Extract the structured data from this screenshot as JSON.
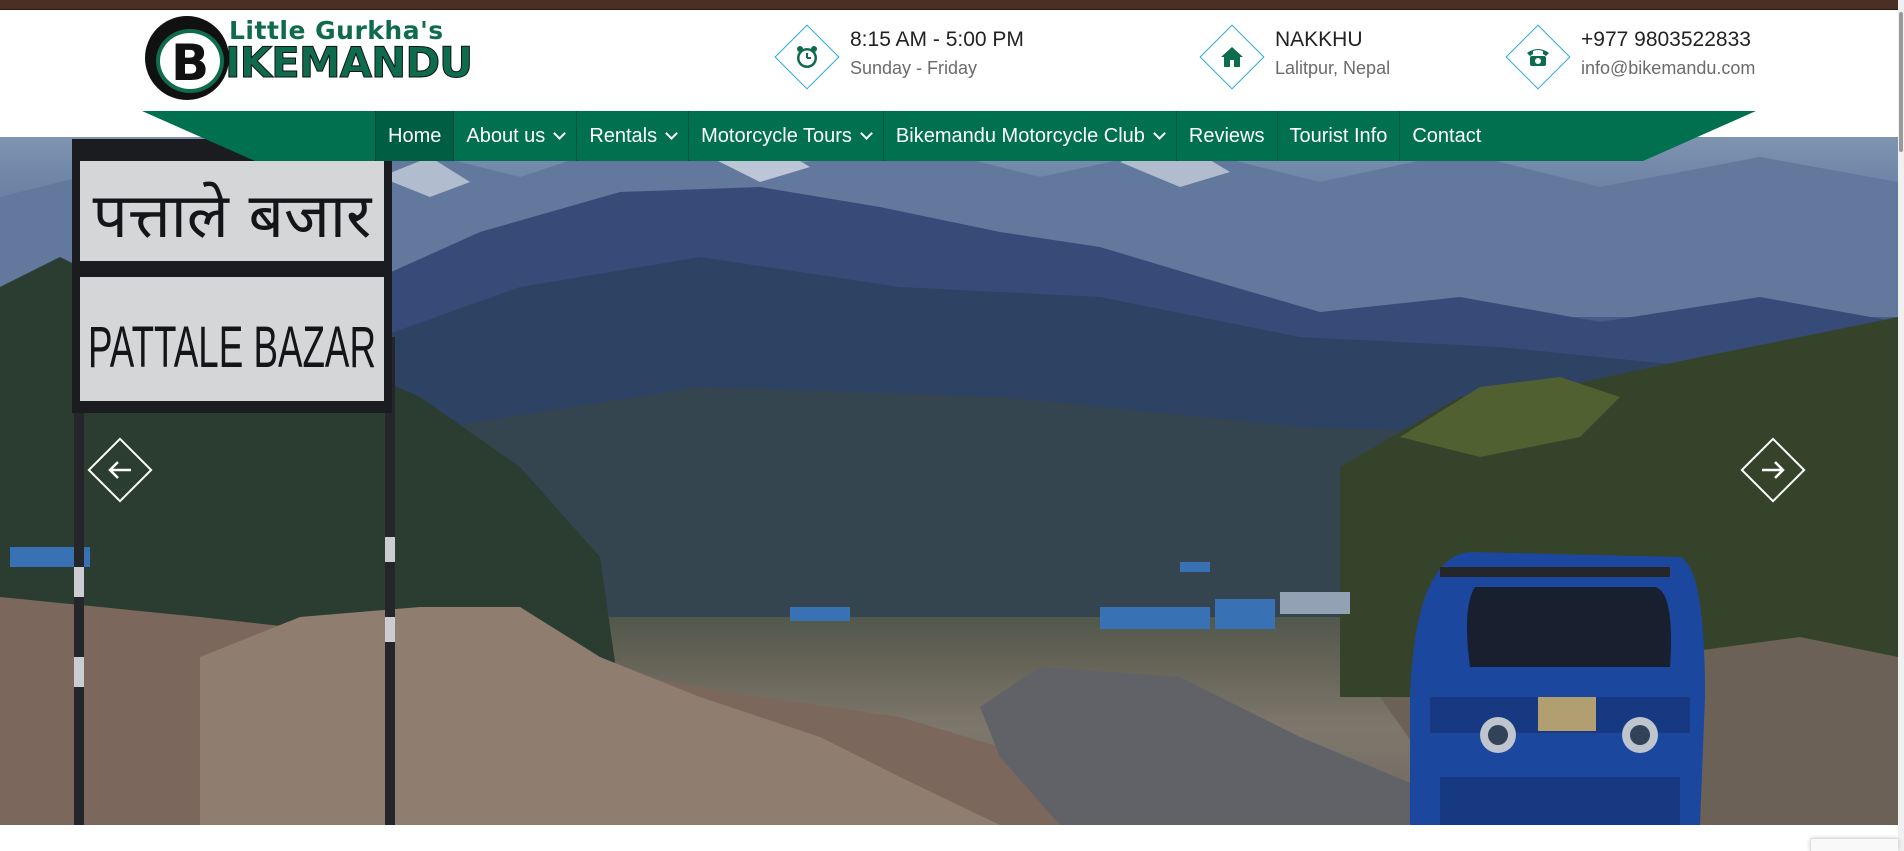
{
  "brand": {
    "small_text": "Little Gurkha's",
    "big_text": "IKEMANDU",
    "badge_letter": "B"
  },
  "contact_blocks": [
    {
      "icon": "clock-icon",
      "title": "8:15 AM - 5:00 PM",
      "subtitle": "Sunday - Friday"
    },
    {
      "icon": "home-icon",
      "title": "NAKKHU",
      "subtitle": "Lalitpur, Nepal"
    },
    {
      "icon": "phone-icon",
      "title": "+977 9803522833",
      "subtitle": "info@bikemandu.com"
    }
  ],
  "nav": {
    "items": [
      {
        "label": "Home",
        "dropdown": false,
        "active": true
      },
      {
        "label": "About us",
        "dropdown": true
      },
      {
        "label": "Rentals",
        "dropdown": true
      },
      {
        "label": "Motorcycle Tours",
        "dropdown": true
      },
      {
        "label": "Bikemandu Motorcycle Club",
        "dropdown": true
      },
      {
        "label": "Reviews",
        "dropdown": false
      },
      {
        "label": "Tourist Info",
        "dropdown": false
      },
      {
        "label": "Contact",
        "dropdown": false
      }
    ]
  },
  "hero": {
    "sign_text_devanagari": "पत्ताले बजार",
    "sign_text_latin": "PATTALE BAZAR"
  },
  "colors": {
    "brand_green": "#00704f",
    "accent_blue": "#29a8d8",
    "top_strip": "#4a2f24"
  }
}
